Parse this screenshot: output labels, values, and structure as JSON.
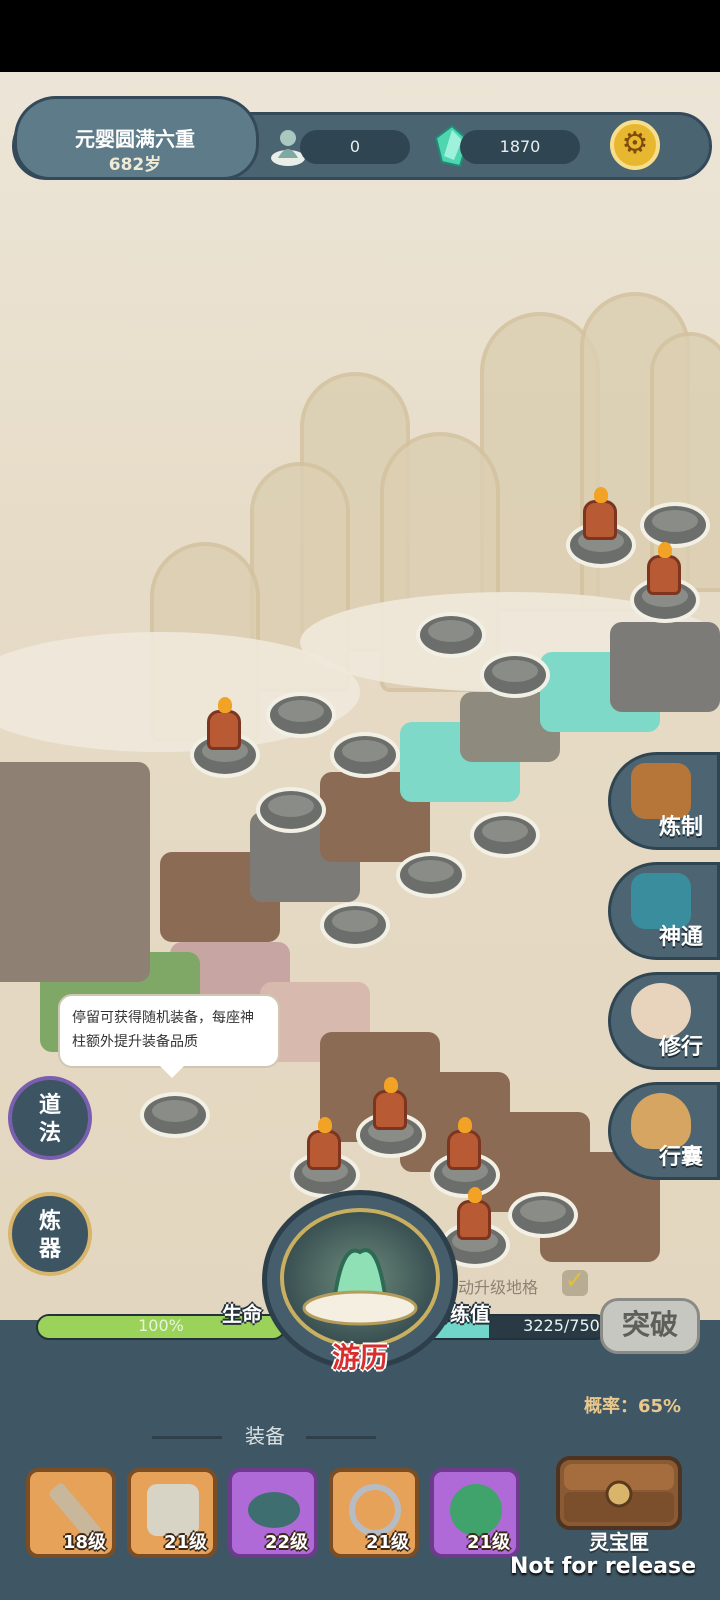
{
  "header": {
    "realm_title": "元婴圆满六重",
    "age": "682岁",
    "resource_1": "0",
    "resource_2": "1870"
  },
  "side_menu": [
    {
      "label": "炼制",
      "icon": "cauldron-icon"
    },
    {
      "label": "神通",
      "icon": "book-icon"
    },
    {
      "label": "修行",
      "icon": "meditate-icon"
    },
    {
      "label": "行囊",
      "icon": "bag-icon"
    }
  ],
  "left_buttons": [
    {
      "label_top": "道",
      "label_bottom": "法"
    },
    {
      "label_top": "炼",
      "label_bottom": "器"
    }
  ],
  "tooltip": "停留可获得随机装备，每座神柱额外提升装备品质",
  "auto_upgrade": {
    "label": "自动升级地格",
    "checked": true
  },
  "stats": {
    "hp_label": "生命",
    "hp_text": "100%",
    "hp_fraction": 1.0,
    "xp_label": "历练值",
    "xp_text": "3225/7500",
    "xp_fraction": 0.43
  },
  "travel_label": "游历",
  "breakthrough_label": "突破",
  "probability": "概率：65%",
  "equipment": {
    "title": "装备",
    "slots": [
      {
        "level": "18级",
        "rarity": "orange",
        "icon": "sword-icon"
      },
      {
        "level": "21级",
        "rarity": "orange",
        "icon": "robe-icon"
      },
      {
        "level": "22级",
        "rarity": "purple",
        "icon": "belt-icon"
      },
      {
        "level": "21级",
        "rarity": "orange",
        "icon": "ring-icon"
      },
      {
        "level": "21级",
        "rarity": "purple",
        "icon": "jade-icon"
      }
    ]
  },
  "chest_label": "灵宝匣",
  "watermark": "Not for release",
  "colors": {
    "orange_slot": "#e7a25a",
    "purple_slot": "#b06ad8",
    "panel": "#3f5764",
    "hp": "#9bd25a",
    "xp": "#6fd6c9"
  }
}
